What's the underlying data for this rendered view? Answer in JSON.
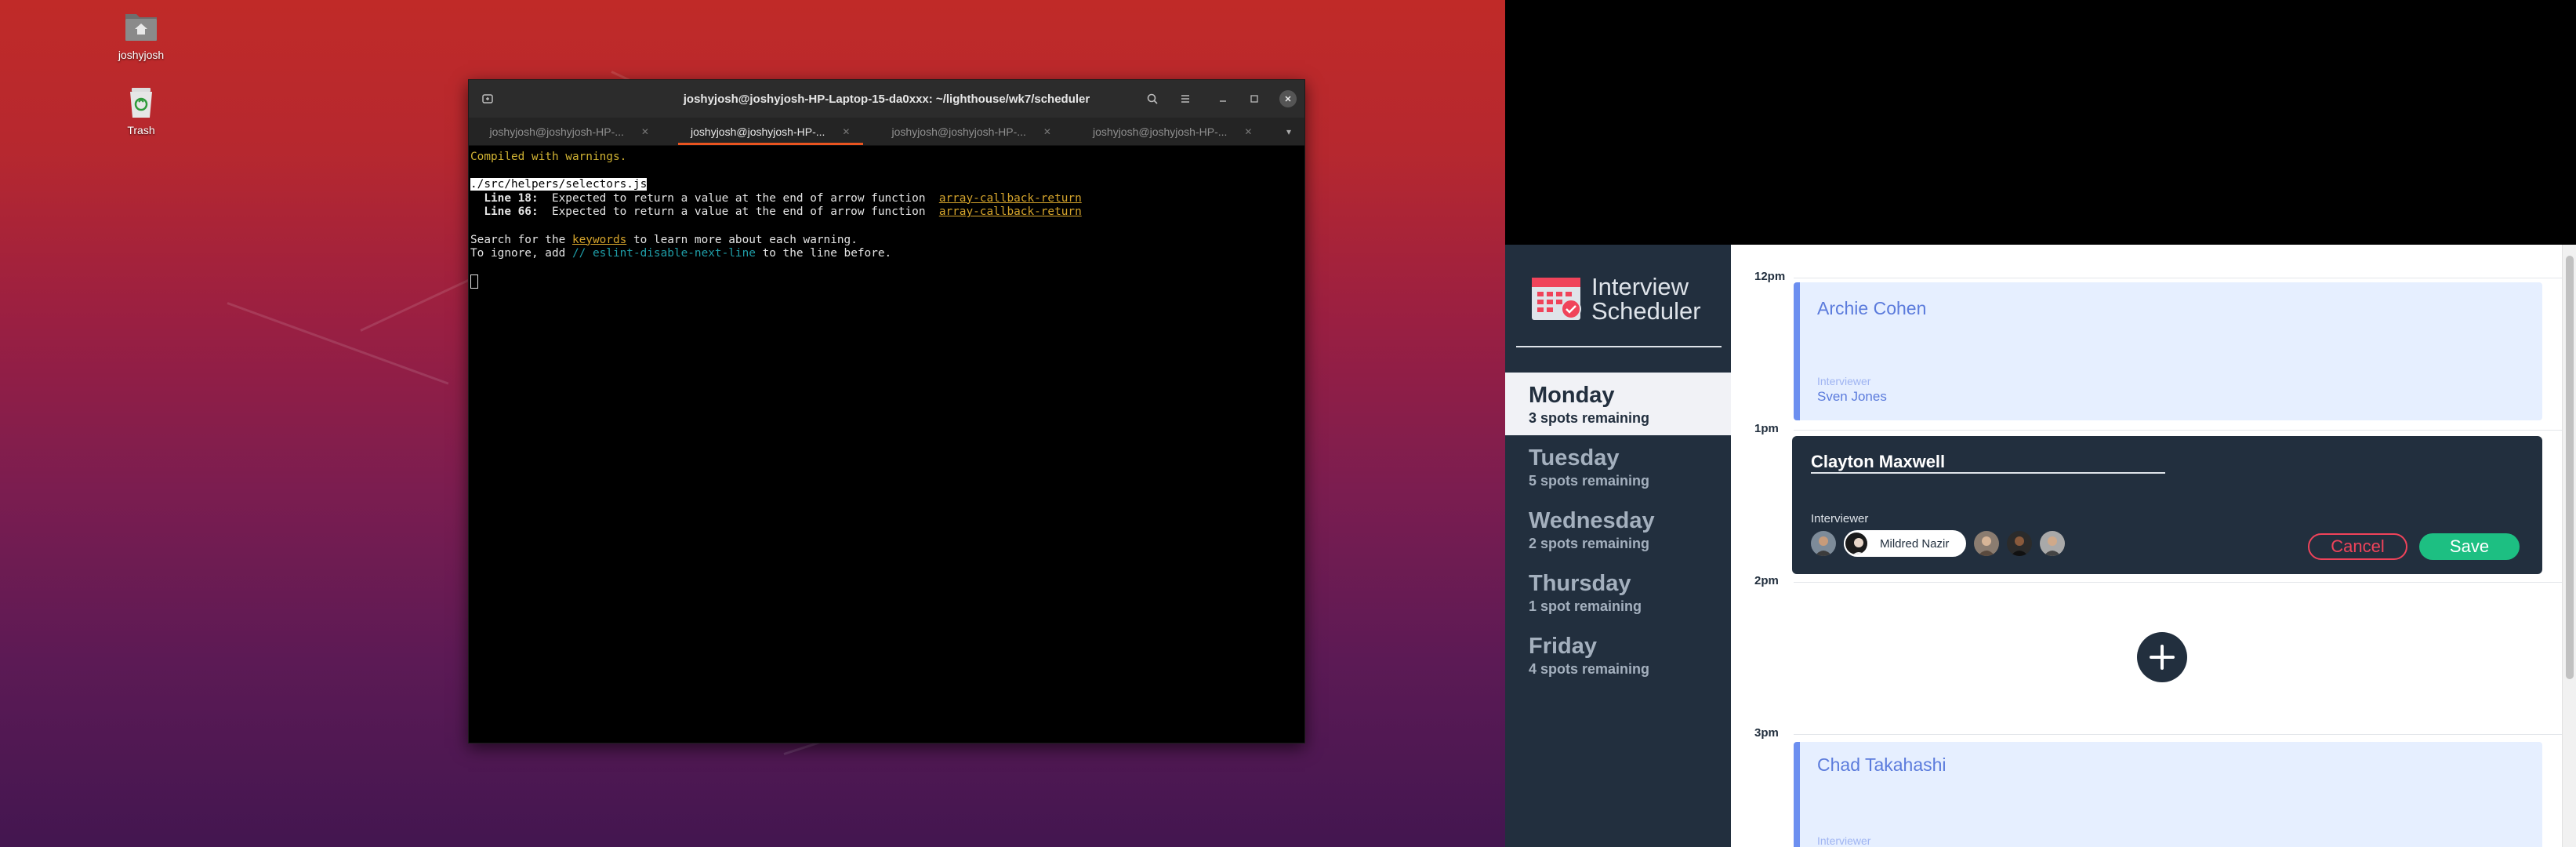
{
  "desktop": {
    "icons": [
      {
        "label": "joshyjosh",
        "icon": "home-folder-icon"
      },
      {
        "label": "Trash",
        "icon": "trash-icon"
      }
    ]
  },
  "terminal": {
    "title": "joshyjosh@joshyjosh-HP-Laptop-15-da0xxx: ~/lighthouse/wk7/scheduler",
    "tabs": [
      {
        "label": "joshyjosh@joshyjosh-HP-..."
      },
      {
        "label": "joshyjosh@joshyjosh-HP-..."
      },
      {
        "label": "joshyjosh@joshyjosh-HP-..."
      },
      {
        "label": "joshyjosh@joshyjosh-HP-..."
      }
    ],
    "output": {
      "compiled": "Compiled with warnings.",
      "file": "./src/helpers/selectors.js",
      "warnings": [
        {
          "line": "  Line 18:",
          "text": "  Expected to return a value at the end of arrow function  ",
          "rule": "array-callback-return"
        },
        {
          "line": "  Line 66:",
          "text": "  Expected to return a value at the end of arrow function  ",
          "rule": "array-callback-return"
        }
      ],
      "search_pre": "Search for the ",
      "search_kw": "keywords",
      "search_post": " to learn more about each warning.",
      "ignore_pre": "To ignore, add ",
      "ignore_code": "// eslint-disable-next-line",
      "ignore_post": " to the line before."
    }
  },
  "app": {
    "logo_line1": "Interview",
    "logo_line2": "Scheduler",
    "days": [
      {
        "name": "Monday",
        "spots": "3 spots remaining",
        "selected": true
      },
      {
        "name": "Tuesday",
        "spots": "5 spots remaining",
        "selected": false
      },
      {
        "name": "Wednesday",
        "spots": "2 spots remaining",
        "selected": false
      },
      {
        "name": "Thursday",
        "spots": "1 spot remaining",
        "selected": false
      },
      {
        "name": "Friday",
        "spots": "4 spots remaining",
        "selected": false
      }
    ],
    "times": [
      "12pm",
      "1pm",
      "2pm",
      "3pm"
    ],
    "appointments": [
      {
        "student": "Archie Cohen",
        "interviewer_label": "Interviewer",
        "interviewer": "Sven Jones"
      },
      {
        "student": "Chad Takahashi",
        "interviewer_label": "Interviewer"
      }
    ],
    "form": {
      "student_value": "Clayton Maxwell",
      "interviewer_label": "Interviewer",
      "selected_interviewer": "Mildred Nazir",
      "cancel_label": "Cancel",
      "save_label": "Save"
    },
    "colors": {
      "sidebar": "#222f3e",
      "card": "#e6efff",
      "accent": "#6c8ff0",
      "danger": "#f0435a",
      "success": "#1dbf82"
    }
  }
}
